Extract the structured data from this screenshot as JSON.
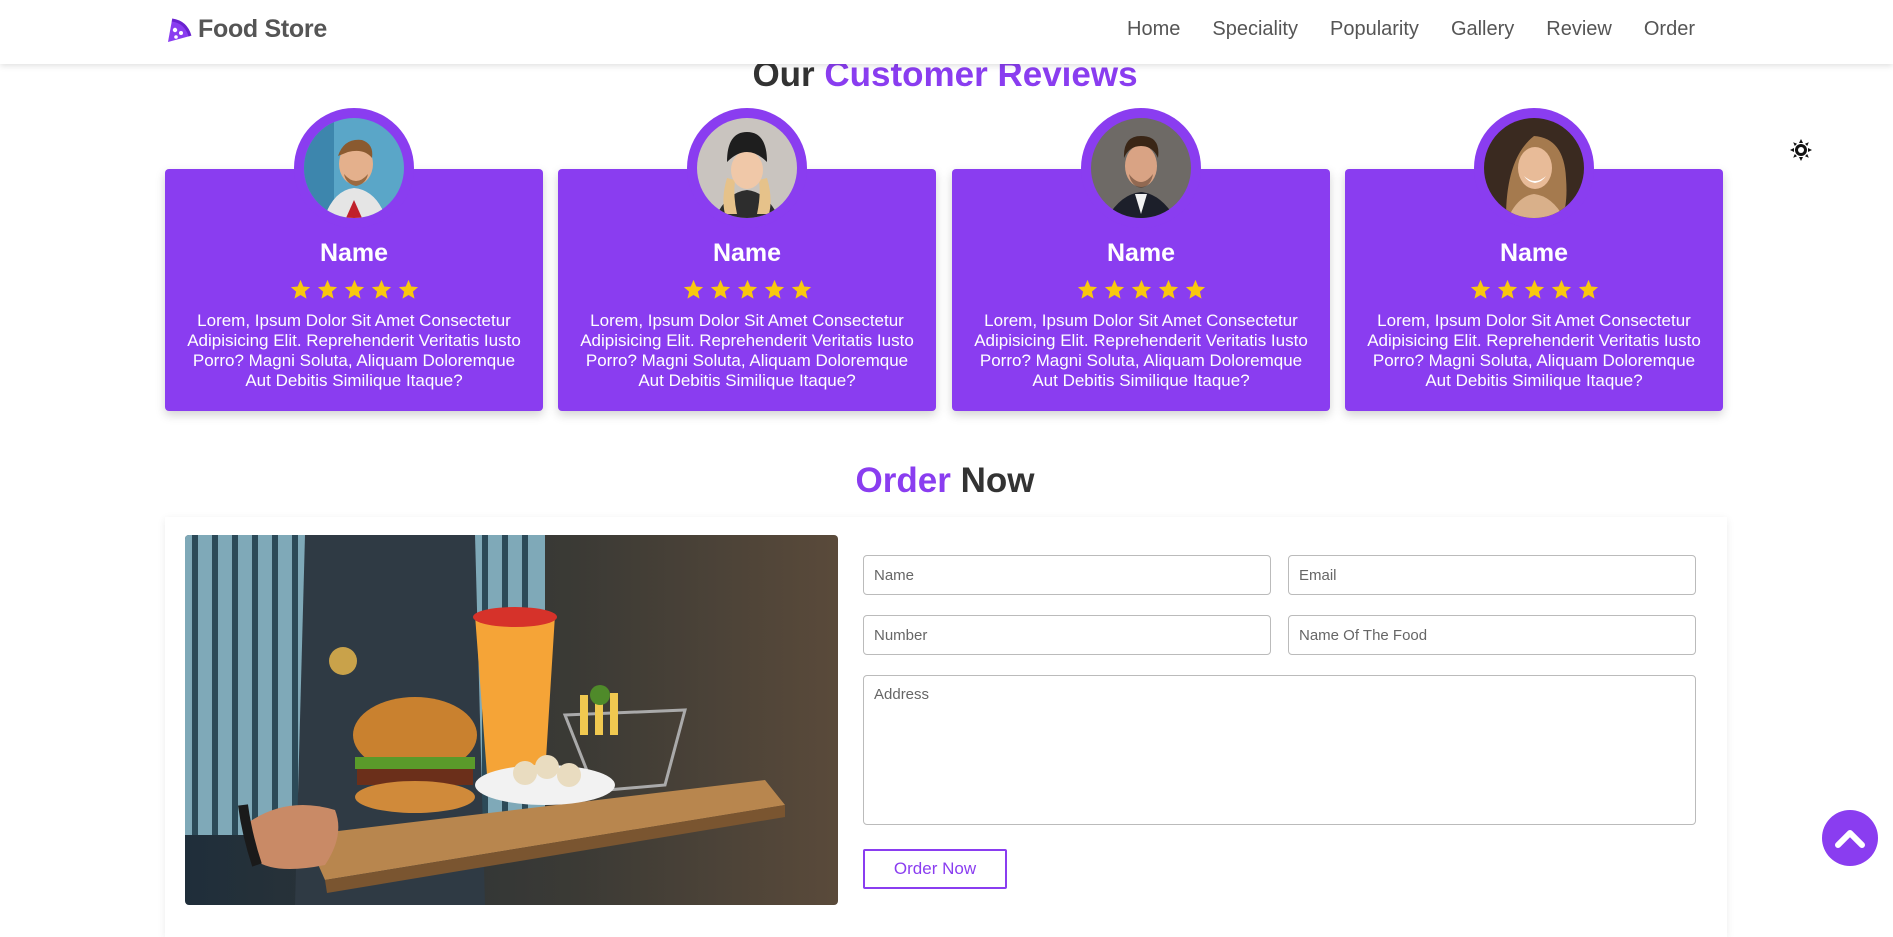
{
  "brand": {
    "name": "Food Store",
    "icon": "pizza-slice-icon"
  },
  "nav": {
    "items": [
      {
        "label": "Home"
      },
      {
        "label": "Speciality"
      },
      {
        "label": "Popularity"
      },
      {
        "label": "Gallery"
      },
      {
        "label": "Review"
      },
      {
        "label": "Order"
      }
    ]
  },
  "reviews": {
    "title_plain": "Our ",
    "title_accent": "Customer Reviews",
    "cards": [
      {
        "name": "Name",
        "rating": 5,
        "text": "Lorem, Ipsum Dolor Sit Amet Consectetur Adipisicing Elit. Reprehenderit Veritatis Iusto Porro? Magni Soluta, Aliquam Doloremque Aut Debitis Similique Itaque?"
      },
      {
        "name": "Name",
        "rating": 5,
        "text": "Lorem, Ipsum Dolor Sit Amet Consectetur Adipisicing Elit. Reprehenderit Veritatis Iusto Porro? Magni Soluta, Aliquam Doloremque Aut Debitis Similique Itaque?"
      },
      {
        "name": "Name",
        "rating": 5,
        "text": "Lorem, Ipsum Dolor Sit Amet Consectetur Adipisicing Elit. Reprehenderit Veritatis Iusto Porro? Magni Soluta, Aliquam Doloremque Aut Debitis Similique Itaque?"
      },
      {
        "name": "Name",
        "rating": 5,
        "text": "Lorem, Ipsum Dolor Sit Amet Consectetur Adipisicing Elit. Reprehenderit Veritatis Iusto Porro? Magni Soluta, Aliquam Doloremque Aut Debitis Similique Itaque?"
      }
    ]
  },
  "order": {
    "title_accent": "Order",
    "title_plain": " Now",
    "fields": {
      "name_placeholder": "Name",
      "email_placeholder": "Email",
      "number_placeholder": "Number",
      "food_placeholder": "Name Of The Food",
      "address_placeholder": "Address"
    },
    "submit_label": "Order Now"
  },
  "widgets": {
    "theme_toggle_icon": "sun-icon",
    "scroll_top_icon": "chevron-up-icon"
  },
  "colors": {
    "accent": "#8a3df0",
    "star": "#f9c80e",
    "text": "#333333"
  }
}
